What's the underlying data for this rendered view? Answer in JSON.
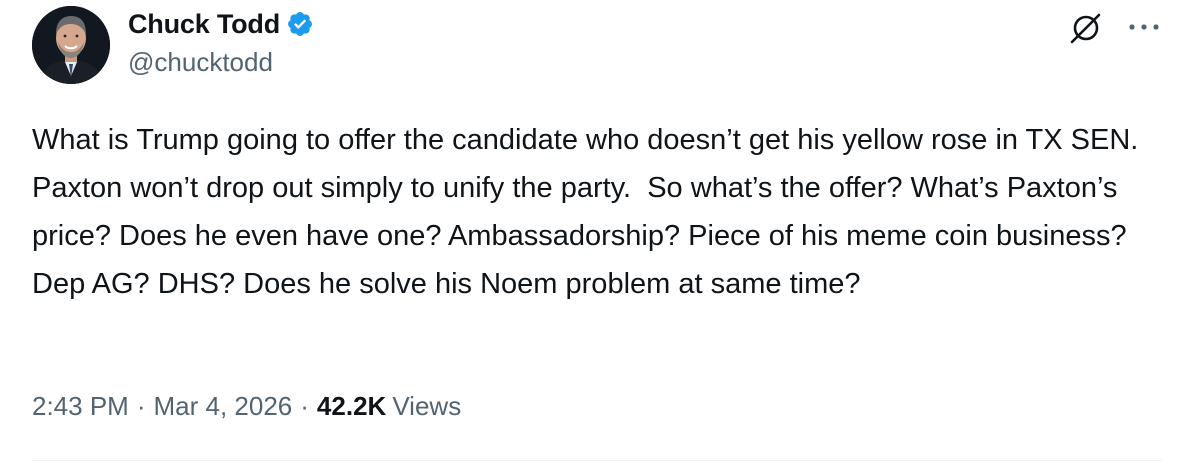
{
  "author": {
    "display_name": "Chuck Todd",
    "handle": "@chucktodd",
    "verified": true
  },
  "tweet": {
    "text": "What is Trump going to offer the candidate who doesn’t get his yellow rose in TX SEN.  Paxton won’t drop out simply to unify the party.  So what’s the offer? What’s Paxton’s price? Does he even have one? Ambassadorship? Piece of his meme coin business? Dep AG? DHS? Does he solve his Noem problem at same time?"
  },
  "meta": {
    "time": "2:43 PM",
    "date": "Mar 4, 2026",
    "separator": "·",
    "views_count": "42.2K",
    "views_label": "Views"
  },
  "icons": {
    "verified": "verified-badge-icon",
    "grok": "grok-icon",
    "more": "more-options-icon"
  },
  "colors": {
    "verified_blue": "#1d9bf0",
    "text_primary": "#0f1419",
    "text_secondary": "#536471"
  }
}
